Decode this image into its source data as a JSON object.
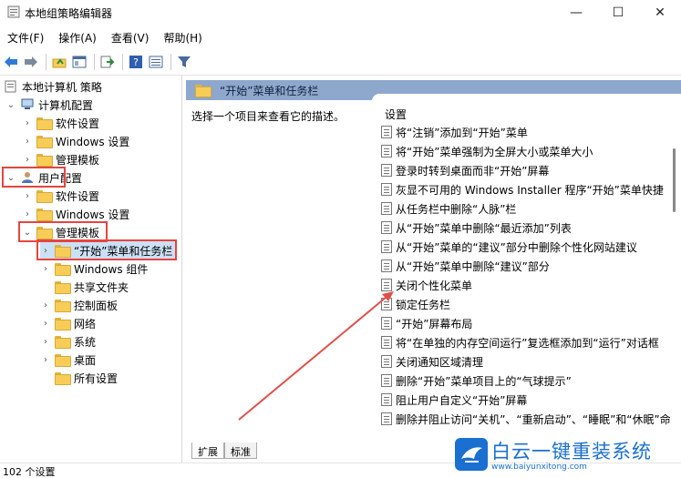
{
  "window": {
    "title": "本地组策略编辑器",
    "min_glyph": "—",
    "max_glyph": "☐",
    "close_glyph": "✕"
  },
  "menu": [
    "文件(F)",
    "操作(A)",
    "查看(V)",
    "帮助(H)"
  ],
  "tree": {
    "root": "本地计算机 策略",
    "computer_config": "计算机配置",
    "cc_software": "软件设置",
    "cc_windows": "Windows 设置",
    "cc_admin": "管理模板",
    "user_config": "用户配置",
    "uc_software": "软件设置",
    "uc_windows": "Windows 设置",
    "uc_admin": "管理模板",
    "start_menu": "“开始”菜单和任务栏",
    "windows_components": "Windows 组件",
    "shared_folders": "共享文件夹",
    "control_panel": "控制面板",
    "network": "网络",
    "system": "系统",
    "desktop": "桌面",
    "all_settings": "所有设置"
  },
  "header": {
    "title": "“开始”菜单和任务栏"
  },
  "description": "选择一个项目来查看它的描述。",
  "settings": {
    "column_title": "设置",
    "items": [
      "将“注销”添加到“开始”菜单",
      "将“开始”菜单强制为全屏大小或菜单大小",
      "登录时转到桌面而非“开始”屏幕",
      "灰显不可用的 Windows Installer 程序“开始”菜单快捷",
      "从任务栏中删除“人脉”栏",
      "从“开始”菜单中删除“最近添加”列表",
      "从“开始”菜单的“建议”部分中删除个性化网站建议",
      "从“开始”菜单中删除“建议”部分",
      "关闭个性化菜单",
      "锁定任务栏",
      "“开始”屏幕布局",
      "将“在单独的内存空间运行”复选框添加到“运行”对话框",
      "关闭通知区域清理",
      "删除“开始”菜单项目上的“气球提示”",
      "阻止用户自定义“开始”屏幕",
      "删除并阻止访问“关机”、“重新启动”、“睡眠”和“休眠”命"
    ]
  },
  "tabs": [
    "扩展",
    "标准"
  ],
  "status": "102 个设置",
  "watermark": {
    "brand": "白云一键重装系统",
    "url": "www.baiyunxitong.com"
  },
  "colors": {
    "header_bg": "#8ea7cc",
    "highlight_red": "#e6453f",
    "arrow_red": "#e0504a",
    "brand_blue": "#1a6fd1"
  }
}
